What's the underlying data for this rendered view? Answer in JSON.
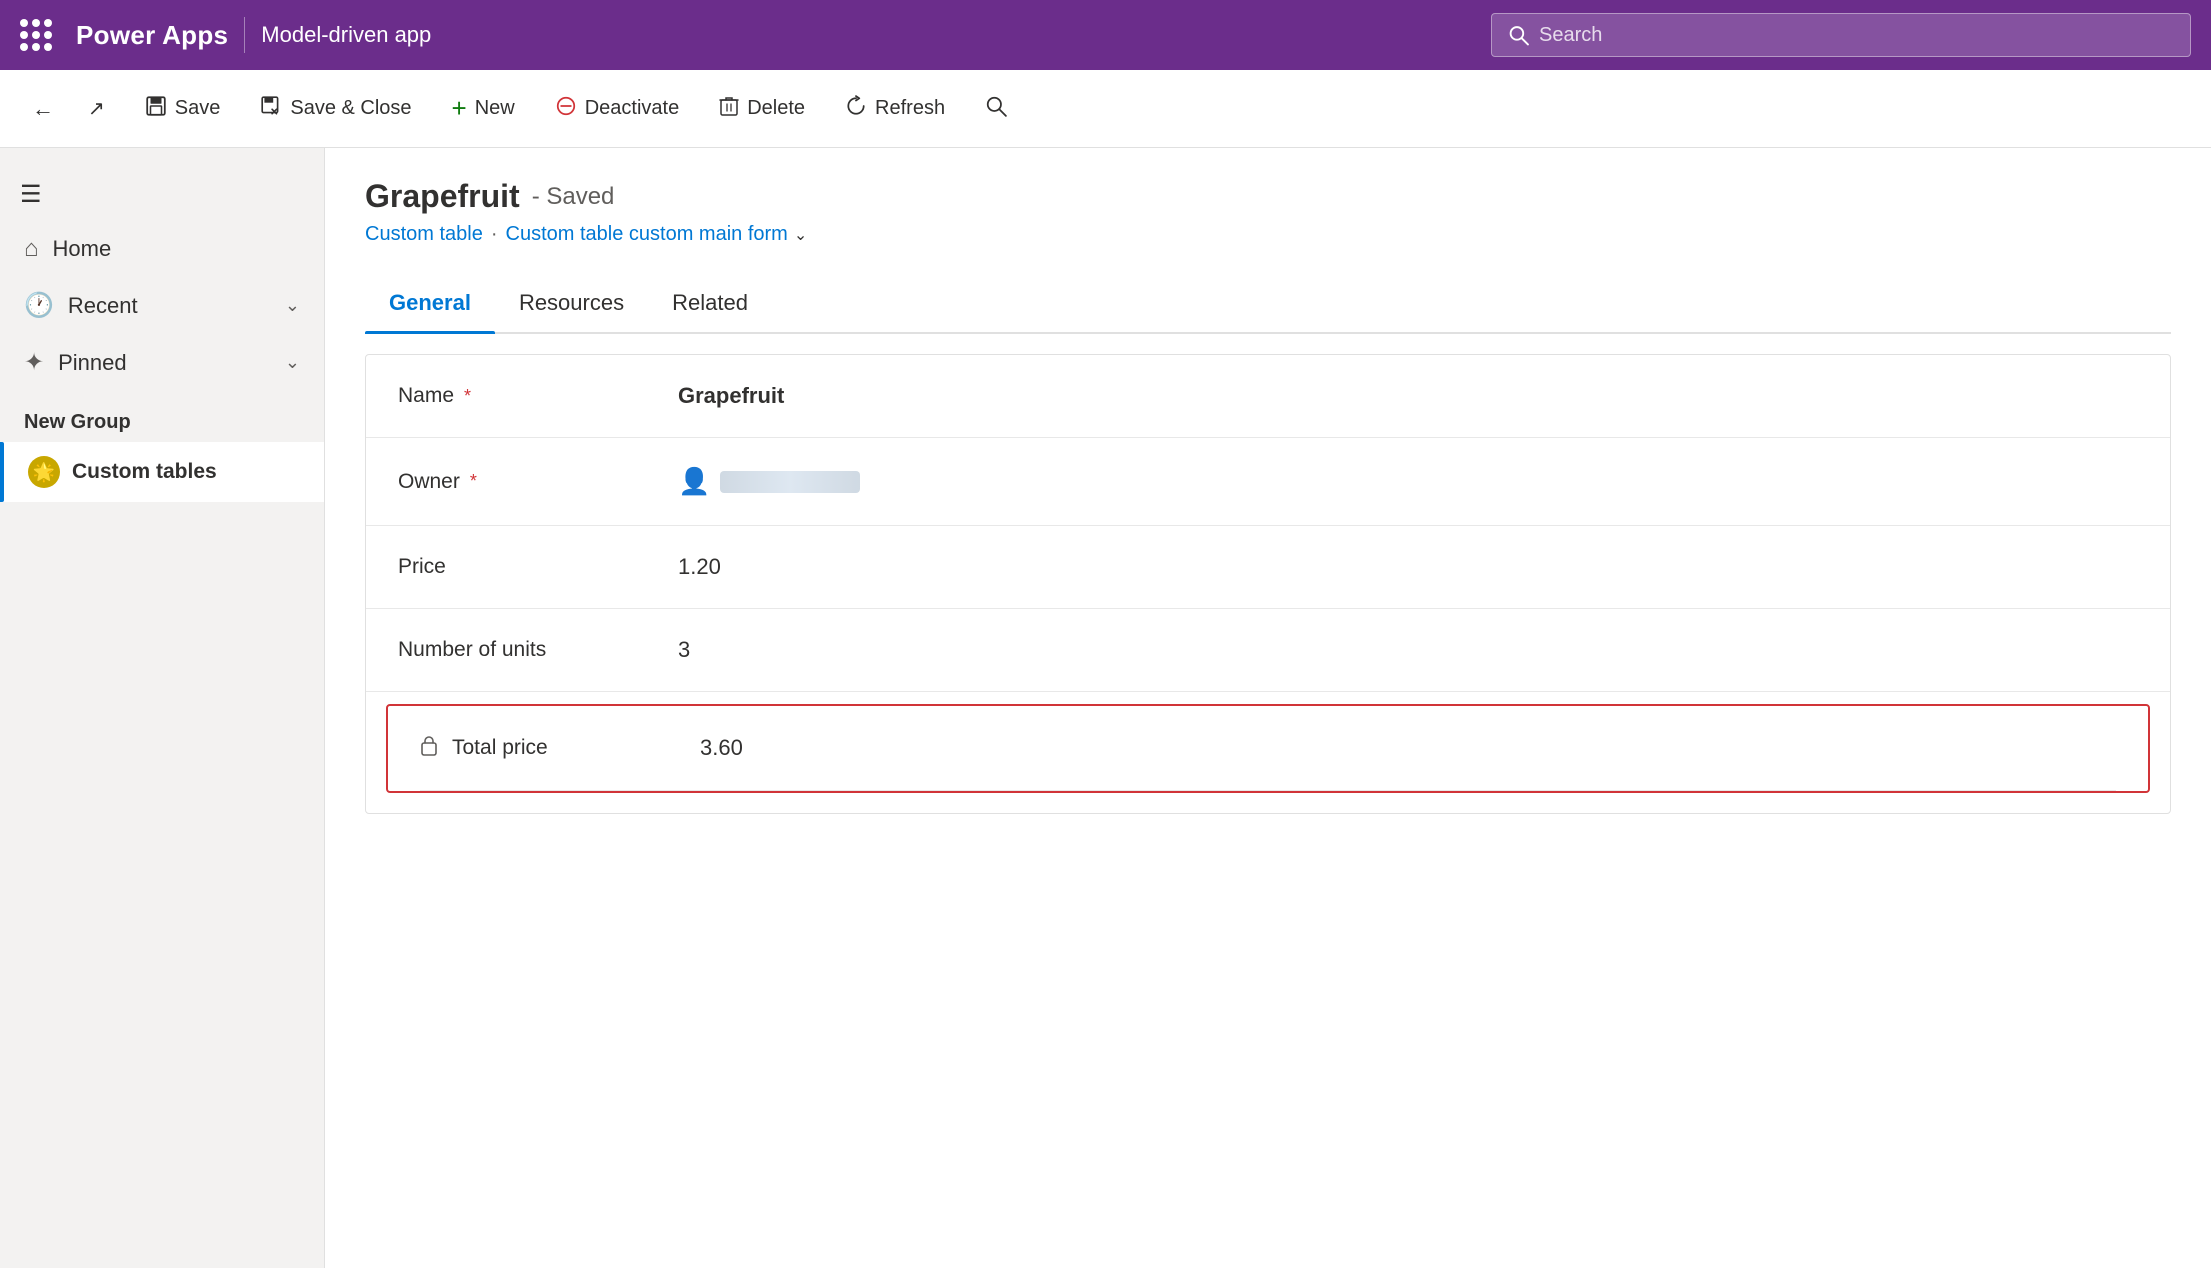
{
  "topbar": {
    "app_name": "Power Apps",
    "app_subtitle": "Model-driven app",
    "search_placeholder": "Search"
  },
  "toolbar": {
    "back_label": "←",
    "external_icon": "↗",
    "save_label": "Save",
    "save_close_label": "Save & Close",
    "new_label": "New",
    "deactivate_label": "Deactivate",
    "delete_label": "Delete",
    "refresh_label": "Refresh",
    "search_icon": "🔍"
  },
  "sidebar": {
    "menu_icon": "☰",
    "home_label": "Home",
    "recent_label": "Recent",
    "pinned_label": "Pinned",
    "new_group_label": "New Group",
    "custom_tables_label": "Custom tables"
  },
  "record": {
    "title": "Grapefruit",
    "saved_status": "- Saved",
    "breadcrumb_table": "Custom table",
    "breadcrumb_sep": "·",
    "breadcrumb_form": "Custom table custom main form",
    "tab_general": "General",
    "tab_resources": "Resources",
    "tab_related": "Related",
    "field_name_label": "Name",
    "field_name_value": "Grapefruit",
    "field_owner_label": "Owner",
    "field_owner_value": "████████",
    "field_price_label": "Price",
    "field_price_value": "1.20",
    "field_units_label": "Number of units",
    "field_units_value": "3",
    "field_total_label": "Total price",
    "field_total_value": "3.60"
  }
}
